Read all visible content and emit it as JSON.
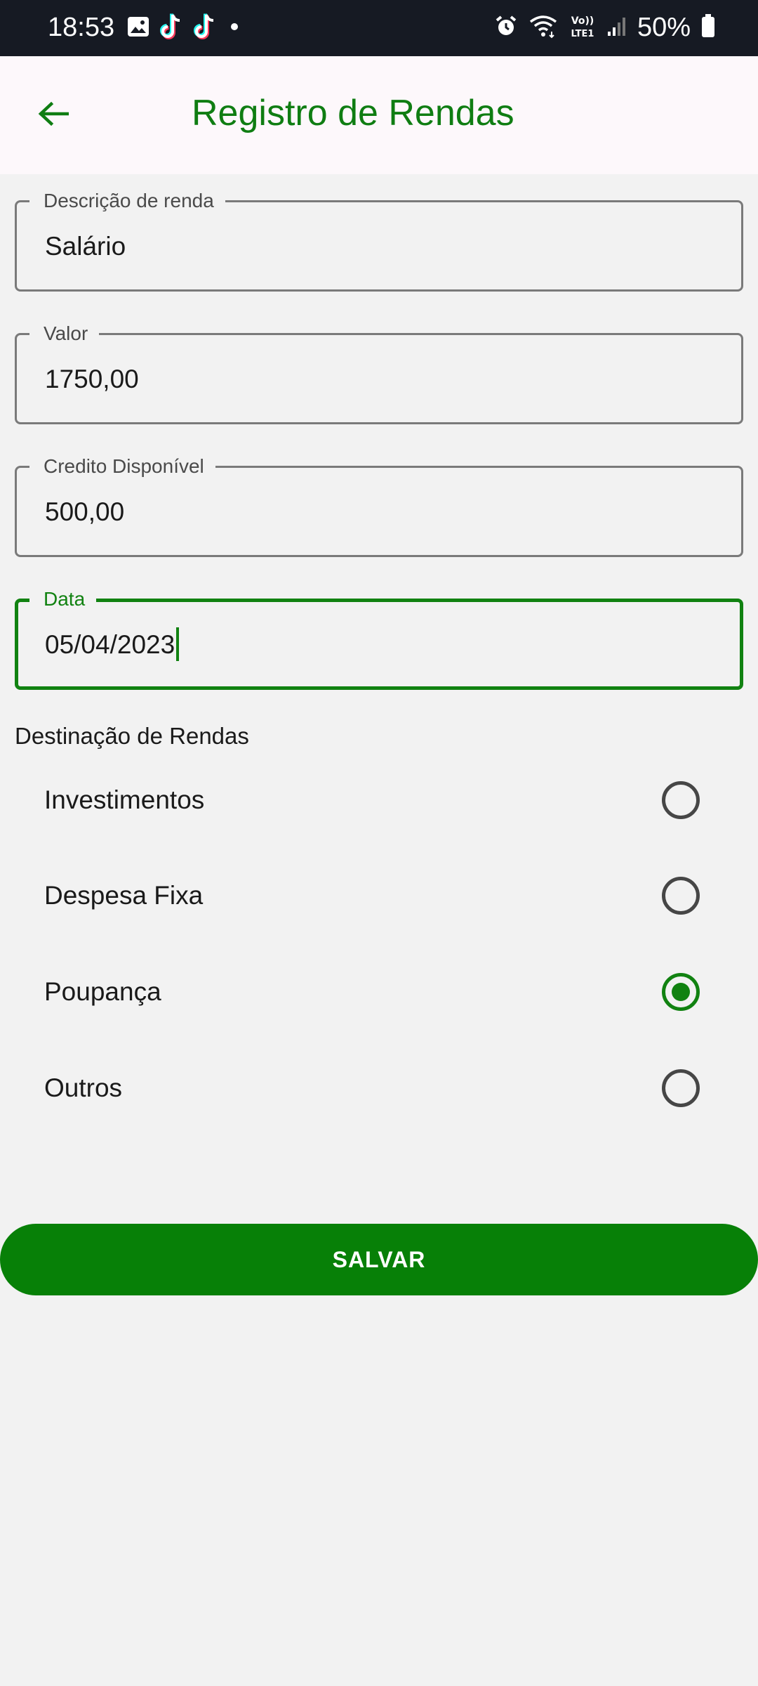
{
  "status_bar": {
    "time": "18:53",
    "battery": "50%",
    "left_icons": [
      "gallery-icon",
      "tiktok-icon",
      "tiktok-icon",
      "dot-icon"
    ],
    "right_icons": [
      "alarm-icon",
      "wifi-icon",
      "volte-icon",
      "signal-icon",
      "battery-icon"
    ]
  },
  "app_bar": {
    "title": "Registro de Rendas",
    "back_icon": "arrow-left-icon",
    "accent_color": "#0f7d12"
  },
  "form": {
    "fields": [
      {
        "label": "Descrição de renda",
        "value": "Salário"
      },
      {
        "label": "Valor",
        "value": "1750,00"
      },
      {
        "label": "Credito Disponível",
        "value": "500,00"
      },
      {
        "label": "Data",
        "value": "05/04/2023",
        "focused": true
      }
    ],
    "destination": {
      "title": "Destinação de Rendas",
      "options": [
        {
          "label": "Investimentos",
          "checked": false
        },
        {
          "label": "Despesa Fixa",
          "checked": false
        },
        {
          "label": "Poupança",
          "checked": true
        },
        {
          "label": "Outros",
          "checked": false
        }
      ]
    },
    "save_label": "SALVAR"
  },
  "colors": {
    "primary": "#078007",
    "status_bar_bg": "#161a23",
    "app_bar_bg": "#fdf8fb",
    "page_bg": "#f2f2f2"
  }
}
